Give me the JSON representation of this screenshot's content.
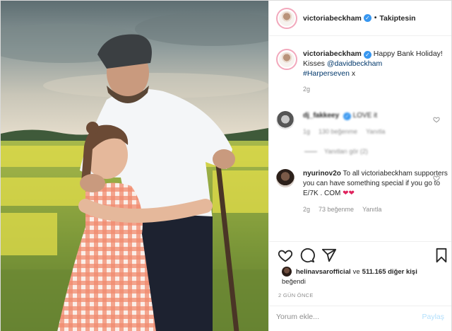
{
  "header": {
    "username": "victoriabeckham",
    "verified_mark": "✓",
    "separator": "•",
    "follow_status": "Takiptesin"
  },
  "caption": {
    "username": "victoriabeckham",
    "text_part1": "Happy Bank Holiday! Kisses ",
    "mention": "@davidbeckham",
    "hashtag": "#Harperseven",
    "text_part2": " x",
    "time": "2g"
  },
  "comments": [
    {
      "username": "dj_fakkeey",
      "text": "LOVE it",
      "time": "1g",
      "likes": "130 beğenme",
      "reply": "Yanıtla",
      "view_replies": "Yanıtları gör (2)",
      "blurred": true
    },
    {
      "username": "nyurinov2o",
      "text": "To all victoriabeckham supporters you can have something special if you go to E/7K . COM",
      "emoji": "❤❤",
      "time": "2g",
      "likes": "73 beğenme",
      "reply": "Yanıtla"
    }
  ],
  "likes": {
    "user": "helinavsarofficial",
    "connector": "ve",
    "others": "511.165 diğer kişi",
    "verb": "beğendi"
  },
  "post_date": "2 GÜN ÖNCE",
  "comment_input": {
    "placeholder": "Yorum ekle...",
    "post_label": "Paylaş"
  },
  "icons": {
    "like": "heart-icon",
    "comment": "comment-bubble-icon",
    "share": "paper-plane-icon",
    "save": "bookmark-icon"
  },
  "colors": {
    "verified": "#3897f0",
    "link": "#00376b",
    "secondary_text": "#8e8e8e",
    "post_button": "#b2dffc",
    "border": "#dbdbdb"
  }
}
